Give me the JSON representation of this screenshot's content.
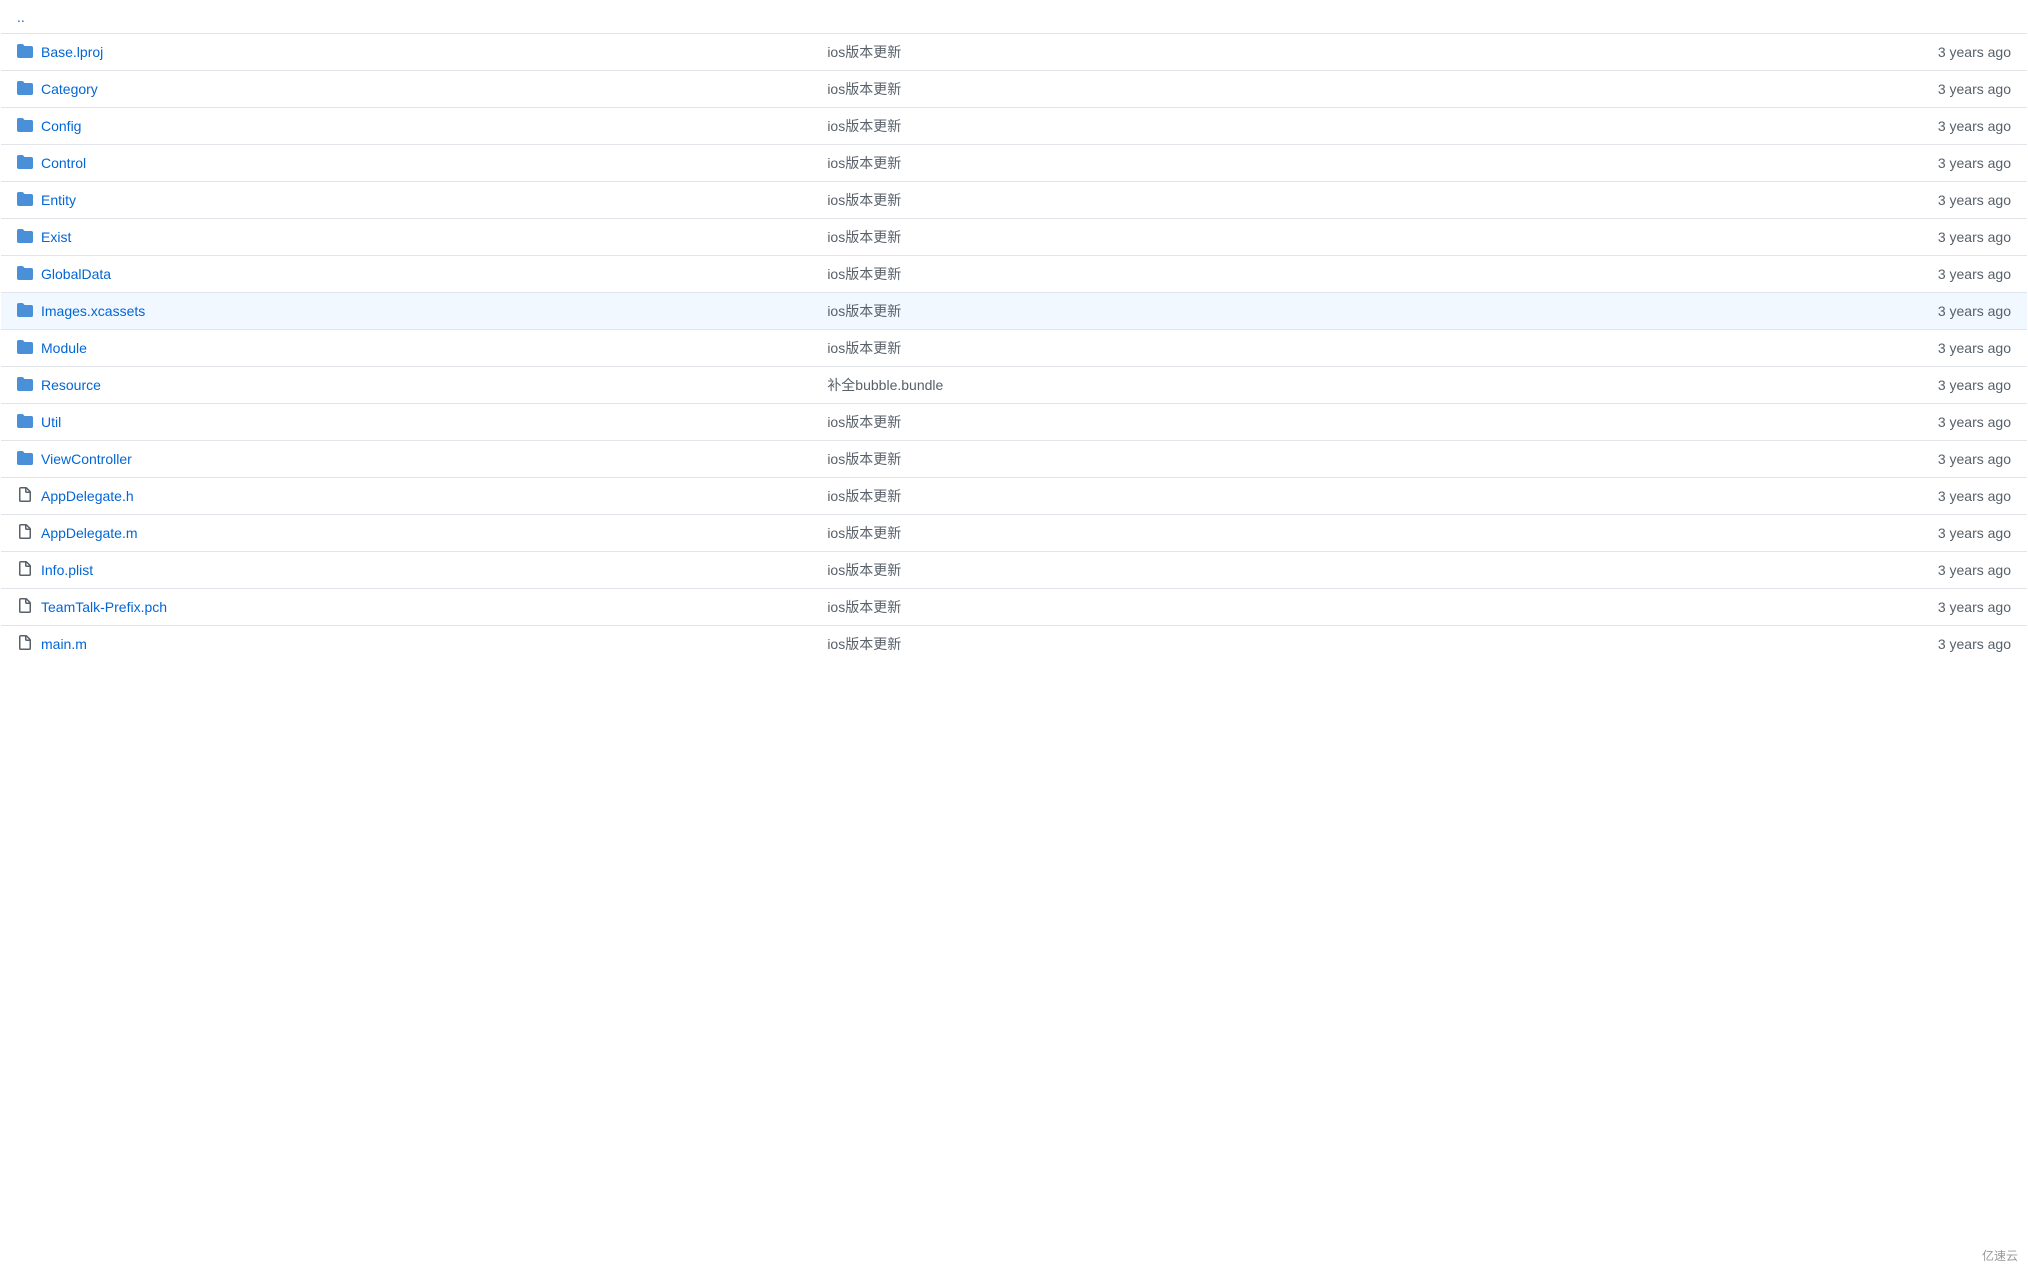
{
  "table": {
    "parent_link": "..",
    "rows": [
      {
        "name": "Base.lproj",
        "type": "folder",
        "message": "ios版本更新",
        "time": "3 years ago",
        "highlighted": false
      },
      {
        "name": "Category",
        "type": "folder",
        "message": "ios版本更新",
        "time": "3 years ago",
        "highlighted": false
      },
      {
        "name": "Config",
        "type": "folder",
        "message": "ios版本更新",
        "time": "3 years ago",
        "highlighted": false
      },
      {
        "name": "Control",
        "type": "folder",
        "message": "ios版本更新",
        "time": "3 years ago",
        "highlighted": false
      },
      {
        "name": "Entity",
        "type": "folder",
        "message": "ios版本更新",
        "time": "3 years ago",
        "highlighted": false
      },
      {
        "name": "Exist",
        "type": "folder",
        "message": "ios版本更新",
        "time": "3 years ago",
        "highlighted": false
      },
      {
        "name": "GlobalData",
        "type": "folder",
        "message": "ios版本更新",
        "time": "3 years ago",
        "highlighted": false
      },
      {
        "name": "Images.xcassets",
        "type": "folder",
        "message": "ios版本更新",
        "time": "3 years ago",
        "highlighted": true
      },
      {
        "name": "Module",
        "type": "folder",
        "message": "ios版本更新",
        "time": "3 years ago",
        "highlighted": false
      },
      {
        "name": "Resource",
        "type": "folder",
        "message": "补全bubble.bundle",
        "time": "3 years ago",
        "highlighted": false
      },
      {
        "name": "Util",
        "type": "folder",
        "message": "ios版本更新",
        "time": "3 years ago",
        "highlighted": false
      },
      {
        "name": "ViewController",
        "type": "folder",
        "message": "ios版本更新",
        "time": "3 years ago",
        "highlighted": false
      },
      {
        "name": "AppDelegate.h",
        "type": "file",
        "message": "ios版本更新",
        "time": "3 years ago",
        "highlighted": false
      },
      {
        "name": "AppDelegate.m",
        "type": "file",
        "message": "ios版本更新",
        "time": "3 years ago",
        "highlighted": false
      },
      {
        "name": "Info.plist",
        "type": "file",
        "message": "ios版本更新",
        "time": "3 years ago",
        "highlighted": false
      },
      {
        "name": "TeamTalk-Prefix.pch",
        "type": "file",
        "message": "ios版本更新",
        "time": "3 years ago",
        "highlighted": false
      },
      {
        "name": "main.m",
        "type": "file",
        "message": "ios版本更新",
        "time": "3 years ago",
        "highlighted": false
      }
    ]
  },
  "watermark": "亿速云"
}
